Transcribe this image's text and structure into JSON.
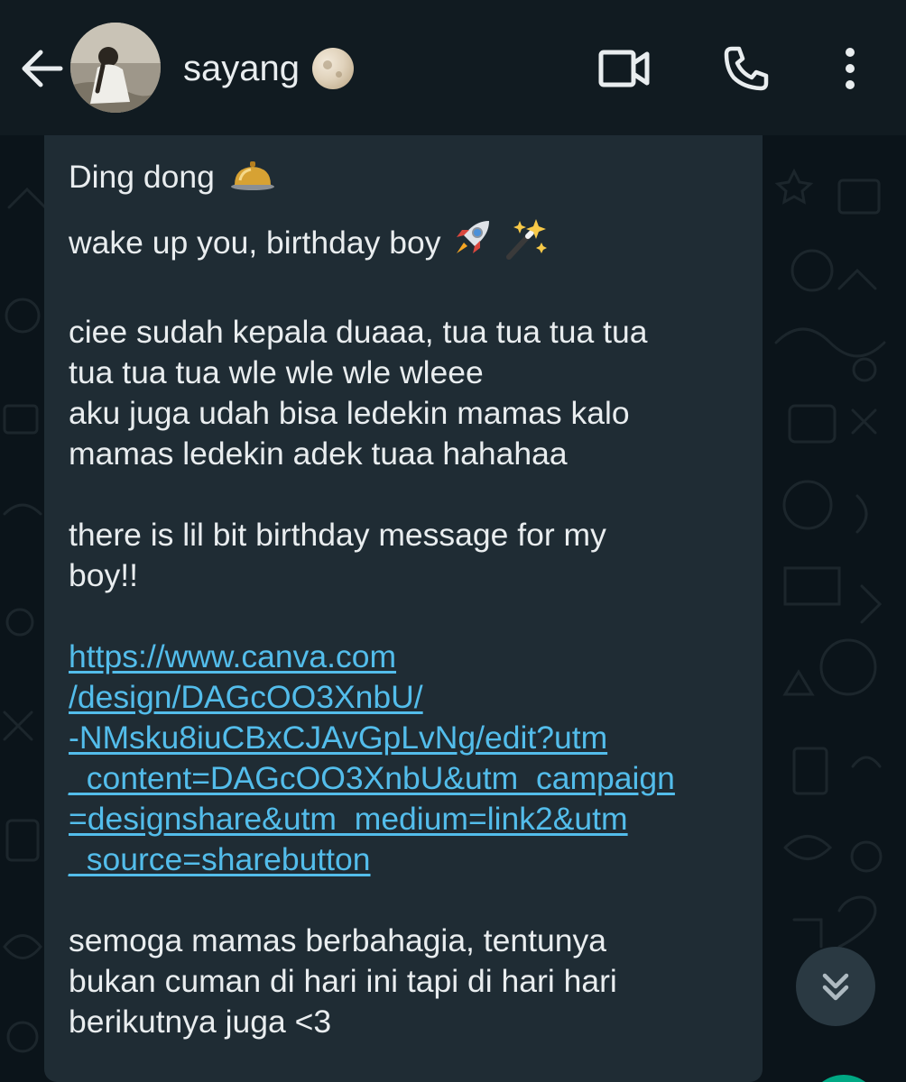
{
  "header": {
    "contact_name": "sayang",
    "status_emoji": "moon-emoji",
    "icons": {
      "back": "back-arrow-icon",
      "video": "video-camera-icon",
      "call": "phone-icon",
      "menu": "more-vertical-icon"
    }
  },
  "message": {
    "line1": "Ding dong",
    "line2": "wake up you, birthday boy",
    "para1_line1": "ciee sudah kepala duaaa, tua tua tua tua",
    "para1_line2": "tua tua tua wle wle wle wleee",
    "para1_line3": "aku juga udah bisa ledekin mamas kalo",
    "para1_line4": "mamas ledekin adek tuaa hahahaa",
    "para2_line1": "there is lil bit birthday message for my",
    "para2_line2": "boy!!",
    "link_line1": "https://www.canva.com",
    "link_line2": "/design/DAGcOO3XnbU/",
    "link_line3": "-NMsku8iuCBxCJAvGpLvNg/edit?utm",
    "link_line4": "_content=DAGcOO3XnbU&utm_campaign",
    "link_line5": "=designshare&utm_medium=link2&utm",
    "link_line6": "_source=sharebutton",
    "para3_line1": "semoga mamas berbahagia, tentunya",
    "para3_line2": "bukan cuman di hari ini tapi di hari hari",
    "para3_line3": "berikutnya juga <3"
  },
  "colors": {
    "header_bg": "#111b21",
    "chat_bg": "#0b141a",
    "bubble_bg": "#1f2c34",
    "text": "#e9edef",
    "link": "#53bdeb",
    "accent": "#00a884"
  }
}
